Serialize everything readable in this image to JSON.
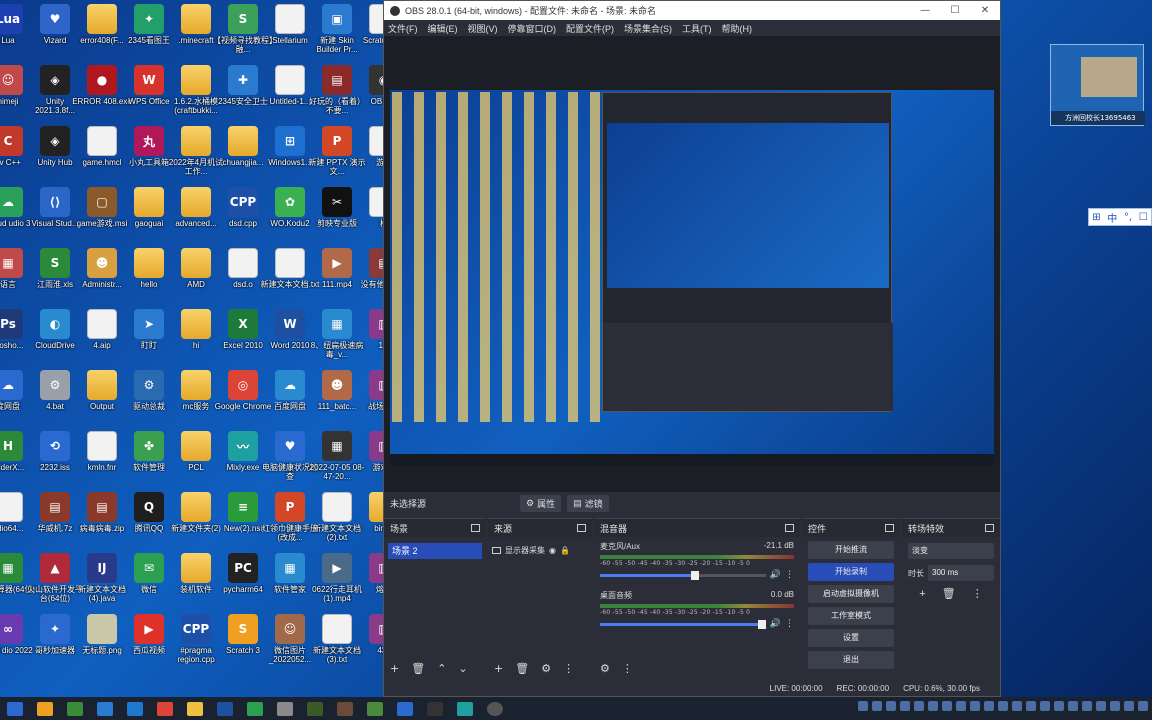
{
  "desktop_icons": [
    {
      "label": "Lua",
      "color": "#1e3fb0",
      "glyph": "Lua"
    },
    {
      "label": "Vizard",
      "color": "#2f65c8",
      "glyph": "♥"
    },
    {
      "label": "error408(F...",
      "color": "folder",
      "glyph": ""
    },
    {
      "label": "2345看图王",
      "color": "#23a06a",
      "glyph": "✦"
    },
    {
      "label": ".minecraft",
      "color": "folder",
      "glyph": ""
    },
    {
      "label": "【视频寻找教程】融...",
      "color": "#3aa05a",
      "glyph": "S"
    },
    {
      "label": "Stellarium",
      "color": "doc",
      "glyph": ""
    },
    {
      "label": "新建 Skin Builder Pr...",
      "color": "#2a7bd0",
      "glyph": "▣"
    },
    {
      "label": "Scratch sb3",
      "color": "doc",
      "glyph": ""
    },
    {
      "label": "nimeji",
      "color": "#c04a4a",
      "glyph": "☺"
    },
    {
      "label": "Unity 2021.3.8f...",
      "color": "#222",
      "glyph": "◈"
    },
    {
      "label": "ERROR 408.exe",
      "color": "#b0181e",
      "glyph": "●"
    },
    {
      "label": "WPS Office",
      "color": "#d8322c",
      "glyph": "W"
    },
    {
      "label": "1.6.2.水桶模(craftbukki...",
      "color": "folder",
      "glyph": ""
    },
    {
      "label": "2345安全卫士",
      "color": "#2a7bd0",
      "glyph": "✚"
    },
    {
      "label": "Untitled-1...",
      "color": "doc",
      "glyph": ""
    },
    {
      "label": "好玩的（看着）不要...",
      "color": "#8b2a2a",
      "glyph": "▤"
    },
    {
      "label": "OBS St",
      "color": "#333",
      "glyph": "◉"
    },
    {
      "label": "ev C++",
      "color": "#c0392b",
      "glyph": "C"
    },
    {
      "label": "Unity Hub",
      "color": "#222",
      "glyph": "◈"
    },
    {
      "label": "game.hmcl",
      "color": "doc",
      "glyph": ""
    },
    {
      "label": "小丸工具箱",
      "color": "#b0185a",
      "glyph": "丸"
    },
    {
      "label": "2022年4月机试工作...",
      "color": "folder",
      "glyph": ""
    },
    {
      "label": "chuangjia...",
      "color": "folder",
      "glyph": ""
    },
    {
      "label": "Windows1...",
      "color": "#1f6fd0",
      "glyph": "⊞"
    },
    {
      "label": "新建 PPTX 演示文...",
      "color": "#d24726",
      "glyph": "P"
    },
    {
      "label": "游戏",
      "color": "doc",
      "glyph": ""
    },
    {
      "label": "Cloud udio 3",
      "color": "#2aa05a",
      "glyph": "☁"
    },
    {
      "label": "Visual Stud...",
      "color": "#2a66c8",
      "glyph": "⟨⟩"
    },
    {
      "label": "game游戏.msi",
      "color": "#8a5a2a",
      "glyph": "▢"
    },
    {
      "label": "gaoguai",
      "color": "folder",
      "glyph": ""
    },
    {
      "label": "advanced...",
      "color": "folder",
      "glyph": ""
    },
    {
      "label": "dsd.cpp",
      "color": "#1e50a8",
      "glyph": "CPP"
    },
    {
      "label": "WO.Kodu2",
      "color": "#3ab050",
      "glyph": "✿"
    },
    {
      "label": "剪映专业版",
      "color": "#111",
      "glyph": "✂"
    },
    {
      "label": "模",
      "color": "doc",
      "glyph": ""
    },
    {
      "label": "语言",
      "color": "#c04a4a",
      "glyph": "▦"
    },
    {
      "label": "江雨淮.xls",
      "color": "#2a8a3a",
      "glyph": "S"
    },
    {
      "label": "Administr...",
      "color": "#d8a040",
      "glyph": "☻"
    },
    {
      "label": "hello",
      "color": "folder",
      "glyph": ""
    },
    {
      "label": "AMD",
      "color": "folder",
      "glyph": ""
    },
    {
      "label": "dsd.o",
      "color": "doc",
      "glyph": ""
    },
    {
      "label": "新建文本文档.txt",
      "color": "doc",
      "glyph": ""
    },
    {
      "label": "111.mp4",
      "color": "#b06a4a",
      "glyph": "▶"
    },
    {
      "label": "没有他病毒...",
      "color": "#8a3a3a",
      "glyph": "▤"
    },
    {
      "label": "otosho...",
      "color": "#1e3a78",
      "glyph": "Ps"
    },
    {
      "label": "CloudDrive",
      "color": "#2a8ad0",
      "glyph": "◐"
    },
    {
      "label": "4.aip",
      "color": "doc",
      "glyph": ""
    },
    {
      "label": "盯盯",
      "color": "#2a7bd0",
      "glyph": "➤"
    },
    {
      "label": "hi",
      "color": "folder",
      "glyph": ""
    },
    {
      "label": "Excel 2010",
      "color": "#1e7a3a",
      "glyph": "X"
    },
    {
      "label": "Word 2010",
      "color": "#1e4fa0",
      "glyph": "W"
    },
    {
      "label": "8、纽扁极速病毒_v...",
      "color": "#2a8ad0",
      "glyph": "▦"
    },
    {
      "label": "1.e",
      "color": "#8a3a8a",
      "glyph": "▥"
    },
    {
      "label": "度网盘",
      "color": "#2a6ad0",
      "glyph": "☁"
    },
    {
      "label": "4.bat",
      "color": "#9aa0aa",
      "glyph": "⚙"
    },
    {
      "label": "Output",
      "color": "folder",
      "glyph": ""
    },
    {
      "label": "驱动总裁",
      "color": "#2a6ab0",
      "glyph": "⚙"
    },
    {
      "label": "mc服务",
      "color": "folder",
      "glyph": ""
    },
    {
      "label": "Google Chrome",
      "color": "#db4437",
      "glyph": "◎"
    },
    {
      "label": "百度网盘",
      "color": "#2a8ad0",
      "glyph": "☁"
    },
    {
      "label": "111_batc...",
      "color": "#b06a4a",
      "glyph": "☻"
    },
    {
      "label": "战场代理",
      "color": "#8a3a8a",
      "glyph": "▥"
    },
    {
      "label": "BilderX...",
      "color": "#2a8a3a",
      "glyph": "H"
    },
    {
      "label": "2232.iss",
      "color": "#2a6ad0",
      "glyph": "⟲"
    },
    {
      "label": "kmln.fnr",
      "color": "doc",
      "glyph": ""
    },
    {
      "label": "软件管理",
      "color": "#3aa050",
      "glyph": "✤"
    },
    {
      "label": "PCL",
      "color": "folder",
      "glyph": ""
    },
    {
      "label": "Mixly.exe",
      "color": "#1ea0a0",
      "glyph": "〰"
    },
    {
      "label": "电脑健康状况检查",
      "color": "#2a6ad0",
      "glyph": "♥"
    },
    {
      "label": "2022-07-05 08-47-20...",
      "color": "#333",
      "glyph": "▦"
    },
    {
      "label": "游戏...",
      "color": "#8a3a8a",
      "glyph": "▥"
    },
    {
      "label": "udio64...",
      "color": "doc",
      "glyph": ""
    },
    {
      "label": "华威机.7z",
      "color": "#8a3a2a",
      "glyph": "▤"
    },
    {
      "label": "病毒病毒.zip",
      "color": "#8a3a2a",
      "glyph": "▤"
    },
    {
      "label": "腾讯QQ",
      "color": "#1e1e1e",
      "glyph": "Q"
    },
    {
      "label": "新建文件夹(2)",
      "color": "folder",
      "glyph": ""
    },
    {
      "label": "New(2).nsi",
      "color": "#2a9a3a",
      "glyph": "≡"
    },
    {
      "label": "红领巾健康手册(改成...",
      "color": "#d24726",
      "glyph": "P"
    },
    {
      "label": "新建文本文档(2).txt",
      "color": "doc",
      "glyph": ""
    },
    {
      "label": "bingo",
      "color": "folder",
      "glyph": ""
    },
    {
      "label": "测计算器(64位)",
      "color": "#2a8a3a",
      "glyph": "▦"
    },
    {
      "label": "火山软件开发平台(64位)",
      "color": "#b02a3a",
      "glyph": "▲"
    },
    {
      "label": "新建文本文档(4).java",
      "color": "#2a3a8a",
      "glyph": "IJ"
    },
    {
      "label": "微信",
      "color": "#2aa050",
      "glyph": "✉"
    },
    {
      "label": "装机软件",
      "color": "folder",
      "glyph": ""
    },
    {
      "label": "pycharm64",
      "color": "#222",
      "glyph": "PC"
    },
    {
      "label": "软件管家",
      "color": "#2a8ad0",
      "glyph": "▦"
    },
    {
      "label": "0622行走耳机(1).mp4",
      "color": "#4a6a8a",
      "glyph": "▶"
    },
    {
      "label": "熔炉",
      "color": "#8a3a8a",
      "glyph": "▥"
    },
    {
      "label": "isual dio 2022",
      "color": "#6a3ab0",
      "glyph": "∞"
    },
    {
      "label": "哥秒加速器",
      "color": "#2a6ad0",
      "glyph": "✦"
    },
    {
      "label": "无标题.png",
      "color": "#c8c8a8",
      "glyph": ""
    },
    {
      "label": "西瓜视频",
      "color": "#e0302a",
      "glyph": "▶"
    },
    {
      "label": "#pragma region.cpp",
      "color": "#1e50a8",
      "glyph": "CPP"
    },
    {
      "label": "Scratch 3",
      "color": "#f0a020",
      "glyph": "S"
    },
    {
      "label": "微信图片_2022052...",
      "color": "#a06a4a",
      "glyph": "☺"
    },
    {
      "label": "新建文本文档(3).txt",
      "color": "doc",
      "glyph": ""
    },
    {
      "label": "433",
      "color": "#8a3a8a",
      "glyph": "▥"
    }
  ],
  "obs": {
    "title": "OBS 28.0.1 (64-bit, windows) - 配置文件: 未命名 - 场景: 未命名",
    "window_buttons": [
      "—",
      "☐",
      "✕"
    ],
    "menu": [
      "文件(F)",
      "编辑(E)",
      "视图(V)",
      "停靠窗口(D)",
      "配置文件(P)",
      "场景集合(S)",
      "工具(T)",
      "帮助(H)"
    ],
    "no_source": "未选择源",
    "properties_label": "属性",
    "filters_label": "滤镜",
    "scenes": {
      "header": "场景",
      "items": [
        "场景 2"
      ]
    },
    "sources": {
      "header": "来源",
      "items": [
        "显示器采集"
      ]
    },
    "mixer": {
      "header": "混音器",
      "channels": [
        {
          "name": "麦克风/Aux",
          "db": "-21.1 dB",
          "level": 0.6
        },
        {
          "name": "桌面音频",
          "db": "0.0 dB",
          "level": 1.0
        }
      ],
      "scale": "-60 -55 -50 -45 -40 -35 -30 -25 -20 -15 -10 -5 0"
    },
    "controls": {
      "header": "控件",
      "buttons": [
        {
          "label": "开始推流",
          "active": false
        },
        {
          "label": "开始录制",
          "active": true
        },
        {
          "label": "启动虚拟摄像机",
          "active": false
        },
        {
          "label": "工作室模式",
          "active": false
        },
        {
          "label": "设置",
          "active": false
        },
        {
          "label": "退出",
          "active": false
        }
      ]
    },
    "transitions": {
      "header": "转场特效",
      "selected": "淡变",
      "duration_label": "时长",
      "duration_value": "300 ms"
    },
    "status": {
      "live": "LIVE: 00:00:00",
      "rec": "REC: 00:00:00",
      "cpu": "CPU: 0.6%, 30.00 fps"
    }
  },
  "widget": {
    "caption": "方洲回校长13695463"
  },
  "ime": {
    "chars": [
      "中",
      "°,",
      "☐"
    ]
  }
}
